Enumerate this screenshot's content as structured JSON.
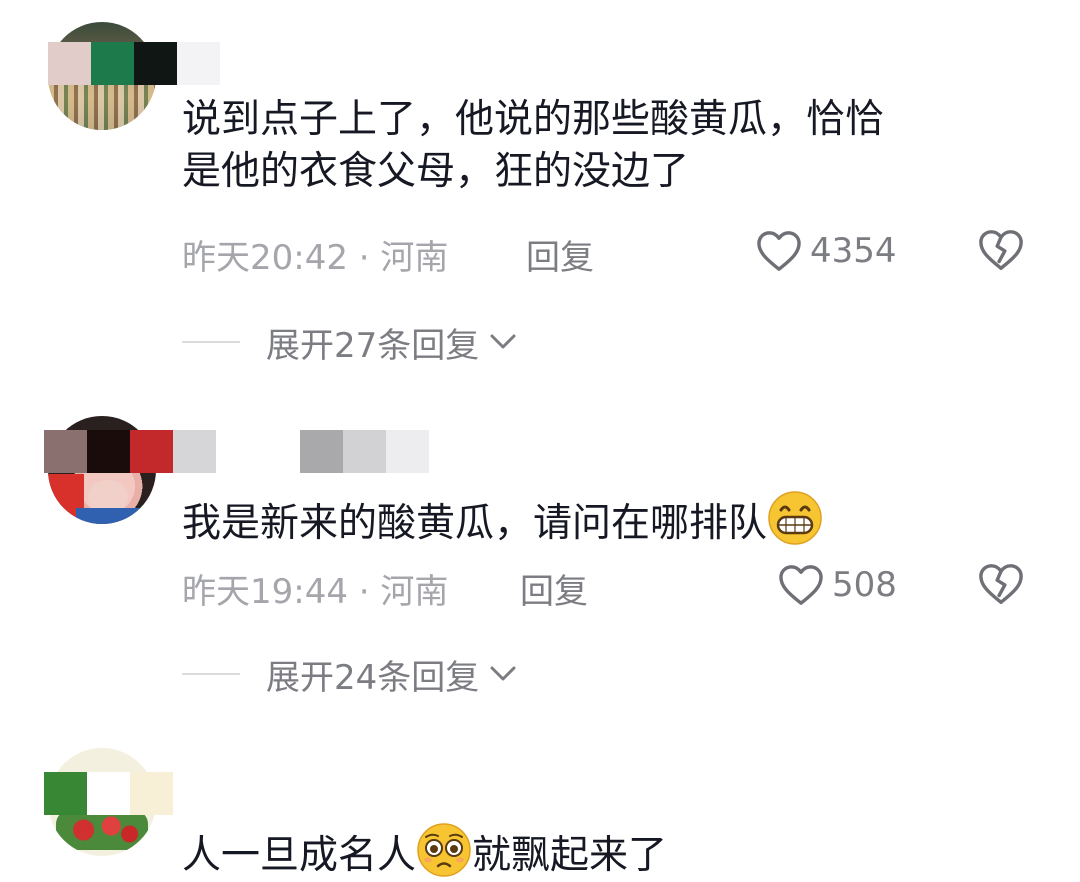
{
  "comments": [
    {
      "text_line1": "说到点子上了，他说的那些酸黄瓜，恰恰",
      "text_line2": "是他的衣食父母，狂的没边了",
      "time_location": "昨天20:42 · 河南",
      "reply_label": "回复",
      "like_count": "4354",
      "expand_label": "展开27条回复"
    },
    {
      "text_before_emoji": "我是新来的酸黄瓜，请问在哪排队",
      "emoji": "grinning-face-emoji",
      "time_location": "昨天19:44 · 河南",
      "reply_label": "回复",
      "like_count": "508",
      "expand_label": "展开24条回复"
    },
    {
      "text_before_emoji": "人一旦成名人",
      "emoji": "pleading-face-emoji",
      "text_after_emoji": "就飘起来了"
    }
  ],
  "icons": {
    "like": "heart-outline-icon",
    "dislike": "broken-heart-icon",
    "expand": "chevron-down-icon"
  },
  "colors": {
    "text_primary": "#161823",
    "text_meta": "#a5a6ab",
    "text_secondary": "#7c7d82",
    "background": "#ffffff"
  }
}
